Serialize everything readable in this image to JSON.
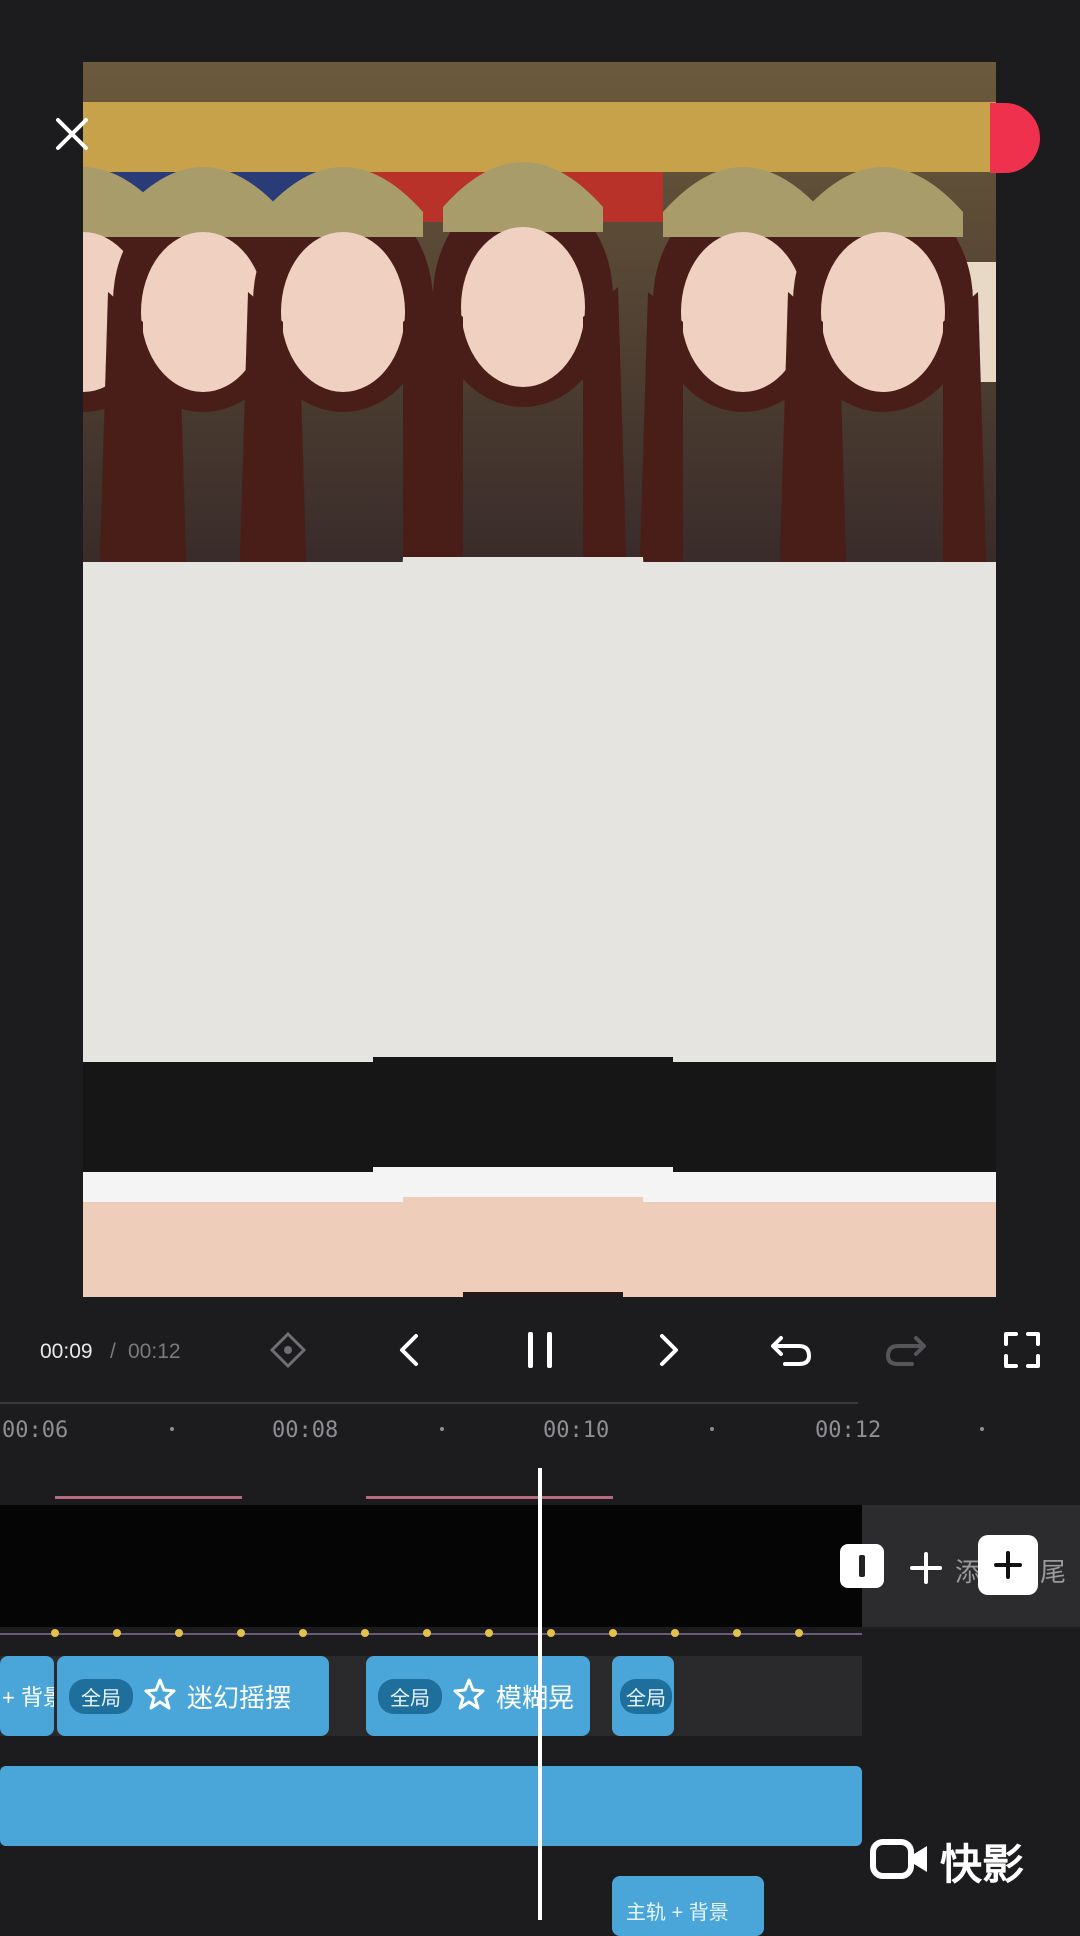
{
  "player": {
    "time_current": "00:09",
    "time_separator": "/",
    "time_total": "00:12"
  },
  "icons": {
    "close": "close-icon",
    "keyframe": "keyframe-diamond-icon",
    "prev": "chevron-left-icon",
    "pause": "pause-icon",
    "next": "chevron-right-icon",
    "undo": "undo-icon",
    "redo": "redo-icon",
    "fullscreen": "fullscreen-icon",
    "add": "plus-icon"
  },
  "timeline": {
    "ticks": [
      "00:06",
      "00:08",
      "00:10",
      "00:12"
    ],
    "end_area_text": "添",
    "end_area_text2": "尾",
    "effect_clips": [
      {
        "tag": "",
        "label": "+ 背景"
      },
      {
        "tag": "全局",
        "label": "迷幻摇摆"
      },
      {
        "tag": "全局",
        "label": "模糊晃"
      },
      {
        "tag": "全局",
        "label": ""
      }
    ],
    "bottom_clip_label": "主轨 + 背景"
  },
  "watermark": {
    "text": "快影"
  },
  "colors": {
    "accent_blue": "#4aa6d8",
    "record_red": "#f0314d",
    "keyframe_yellow": "#e4c24a"
  }
}
